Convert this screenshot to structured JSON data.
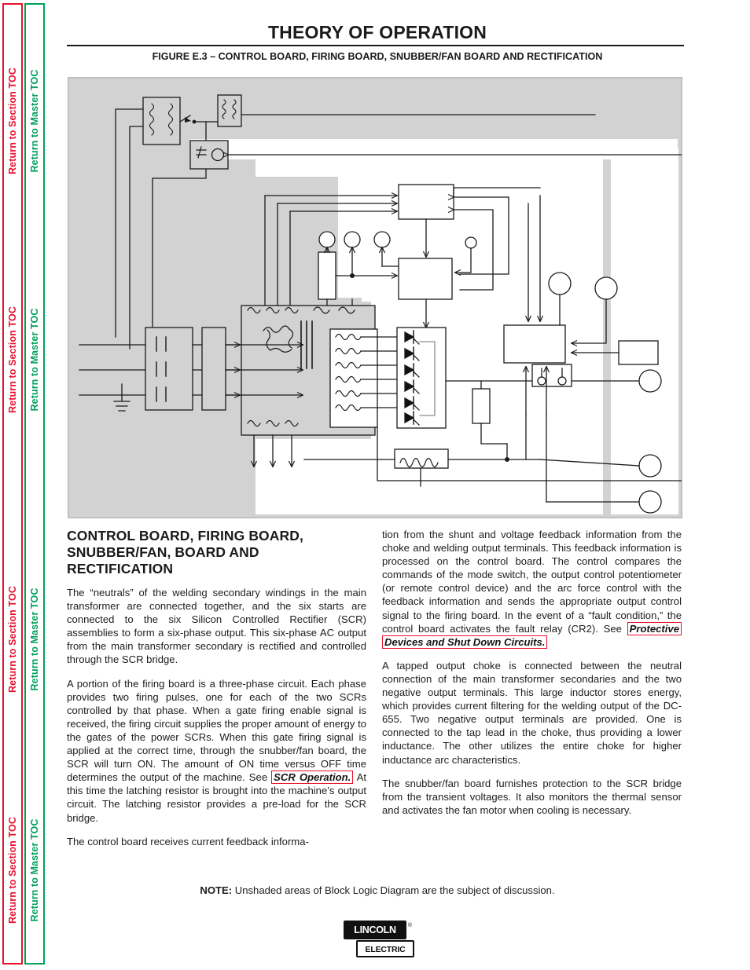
{
  "sidebar": {
    "section_toc_label": "Return to Section TOC",
    "master_toc_label": "Return to Master TOC",
    "section_toc_color": "#e8112d",
    "master_toc_color": "#00a05a"
  },
  "header": {
    "title": "THEORY OF OPERATION",
    "figure_caption": "FIGURE E.3 – CONTROL BOARD, FIRING BOARD, SNUBBER/FAN BOARD AND RECTIFICATION"
  },
  "figure": {
    "name": "block-logic-diagram",
    "shaded_fill": "#d2d2d2",
    "unshaded_fill": "#ffffff",
    "line_color": "#1a1a1a"
  },
  "main": {
    "left_column": {
      "heading": "CONTROL BOARD, FIRING BOARD, SNUBBER/FAN, BOARD AND RECTIFICATION",
      "paragraph_1": "The “neutrals” of the welding secondary windings in the main transformer are connected together, and the six starts are connected to the six Silicon Controlled Rectifier (SCR) assemblies to form a six-phase output. This six-phase AC output from the main transformer secondary is rectified and controlled through the SCR bridge.",
      "paragraph_2_before": "A portion of the firing board is a three-phase circuit. Each phase provides two firing pulses, one for each of the two SCRs controlled by that phase. When a gate firing enable signal is received, the firing circuit supplies the proper amount of energy to the gates of the power SCRs. When this gate firing signal is applied at the correct time, through the snubber/fan board, the SCR will turn ON. The amount of ON time versus OFF time determines the output of the machine. See ",
      "paragraph_2_link": "SCR Operation.",
      "paragraph_2_after": " At this time the latching resistor is brought into the machine’s output circuit. The latching resistor provides a pre-load for the SCR bridge.",
      "paragraph_3": "The control board receives current feedback informa-"
    },
    "right_column": {
      "paragraph_1_before": "tion from the shunt and voltage feedback information from the choke and welding output terminals. This feedback information is processed on the control board. The control compares the commands of the mode switch, the output control potentiometer (or remote control device) and the arc force control with the feedback information and sends the appropriate output control signal to the firing board. In the event of a “fault condition,” the control board activates the fault relay (CR2). See ",
      "paragraph_1_link": "Protective Devices and Shut Down Circuits.",
      "paragraph_2": "A tapped output choke is connected between the neutral connection of the main transformer secondaries and the two negative output terminals. This large inductor stores energy, which provides current filtering for the welding output of the DC-655. Two negative output terminals are provided. One is connected to the tap lead in the choke, thus providing a lower inductance. The other utilizes the entire choke for higher inductance arc characteristics.",
      "paragraph_3": "The snubber/fan board furnishes protection to the SCR bridge from the transient voltages. It also monitors the thermal sensor and activates the fan motor when cooling is necessary."
    }
  },
  "note": {
    "label": "NOTE:",
    "text": "Unshaded areas of Block Logic Diagram are the subject of discussion."
  },
  "footer": {
    "logo_line_1": "LINCOLN",
    "logo_line_2": "ELECTRIC",
    "logo_registered": "®"
  }
}
